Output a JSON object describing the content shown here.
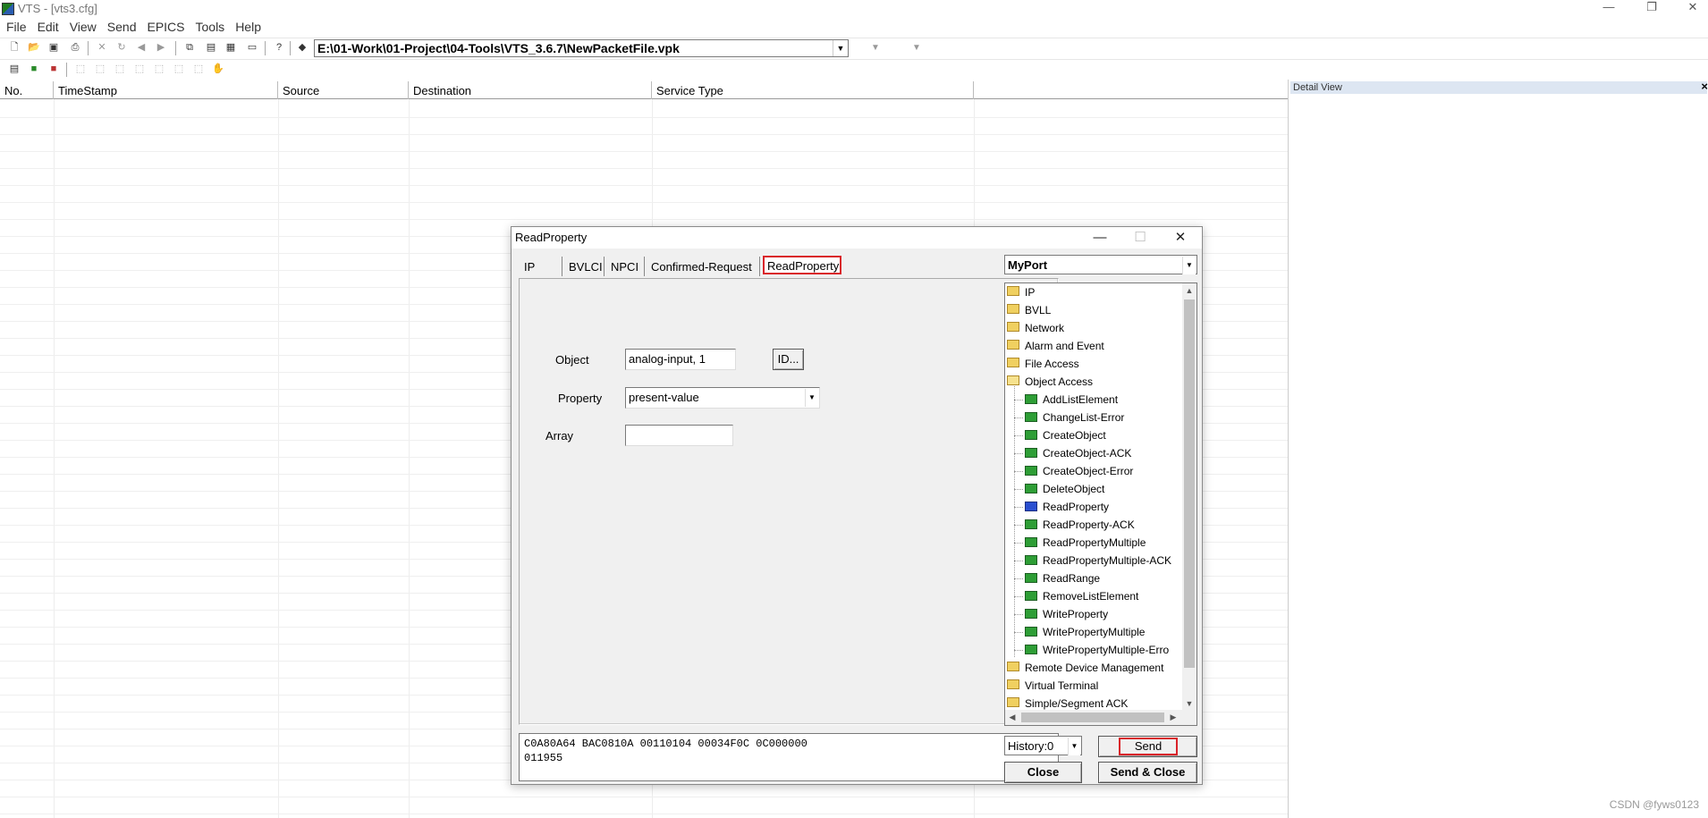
{
  "window": {
    "title": "VTS - [vts3.cfg]",
    "controls": [
      "—",
      "❐",
      "✕"
    ]
  },
  "menu": [
    "File",
    "Edit",
    "View",
    "Send",
    "EPICS",
    "Tools",
    "Help"
  ],
  "toolbar": {
    "path": "E:\\01-Work\\01-Project\\04-Tools\\VTS_3.6.7\\NewPacketFile.vpk"
  },
  "list": {
    "columns": [
      "No.",
      "TimeStamp",
      "Source",
      "Destination",
      "Service Type"
    ]
  },
  "detail_view": {
    "title": "Detail View",
    "close": "×"
  },
  "dialog": {
    "title": "ReadProperty",
    "tabs": [
      "IP",
      "BVLCI",
      "NPCI",
      "Confirmed-Request",
      "ReadProperty"
    ],
    "active_tab": "ReadProperty",
    "fields": {
      "object_label": "Object",
      "object_value": "analog-input, 1",
      "id_button": "ID...",
      "property_label": "Property",
      "property_value": "present-value",
      "array_label": "Array",
      "array_value": ""
    },
    "hex_lines": [
      "C0A80A64 BAC0810A 00110104 00034F0C 0C000000",
      "011955"
    ],
    "port": "MyPort",
    "tree": [
      {
        "label": "IP",
        "type": "folder",
        "level": 0
      },
      {
        "label": "BVLL",
        "type": "folder",
        "level": 0
      },
      {
        "label": "Network",
        "type": "folder",
        "level": 0
      },
      {
        "label": "Alarm and Event",
        "type": "folder",
        "level": 0
      },
      {
        "label": "File Access",
        "type": "folder",
        "level": 0
      },
      {
        "label": "Object Access",
        "type": "folder-open",
        "level": 0
      },
      {
        "label": "AddListElement",
        "type": "msg",
        "level": 1
      },
      {
        "label": "ChangeList-Error",
        "type": "msg",
        "level": 1
      },
      {
        "label": "CreateObject",
        "type": "msg",
        "level": 1
      },
      {
        "label": "CreateObject-ACK",
        "type": "msg",
        "level": 1
      },
      {
        "label": "CreateObject-Error",
        "type": "msg",
        "level": 1
      },
      {
        "label": "DeleteObject",
        "type": "msg",
        "level": 1
      },
      {
        "label": "ReadProperty",
        "type": "msg-selected",
        "level": 1
      },
      {
        "label": "ReadProperty-ACK",
        "type": "msg",
        "level": 1
      },
      {
        "label": "ReadPropertyMultiple",
        "type": "msg",
        "level": 1
      },
      {
        "label": "ReadPropertyMultiple-ACK",
        "type": "msg",
        "level": 1
      },
      {
        "label": "ReadRange",
        "type": "msg",
        "level": 1
      },
      {
        "label": "RemoveListElement",
        "type": "msg",
        "level": 1
      },
      {
        "label": "WriteProperty",
        "type": "msg",
        "level": 1
      },
      {
        "label": "WritePropertyMultiple",
        "type": "msg",
        "level": 1
      },
      {
        "label": "WritePropertyMultiple-Erro",
        "type": "msg",
        "level": 1
      },
      {
        "label": "Remote Device Management",
        "type": "folder",
        "level": 0
      },
      {
        "label": "Virtual Terminal",
        "type": "folder",
        "level": 0
      },
      {
        "label": "Simple/Segment ACK",
        "type": "folder",
        "level": 0
      }
    ],
    "history": "History:0",
    "send": "Send",
    "close": "Close",
    "send_close": "Send & Close"
  },
  "watermark": "CSDN @fyws0123"
}
